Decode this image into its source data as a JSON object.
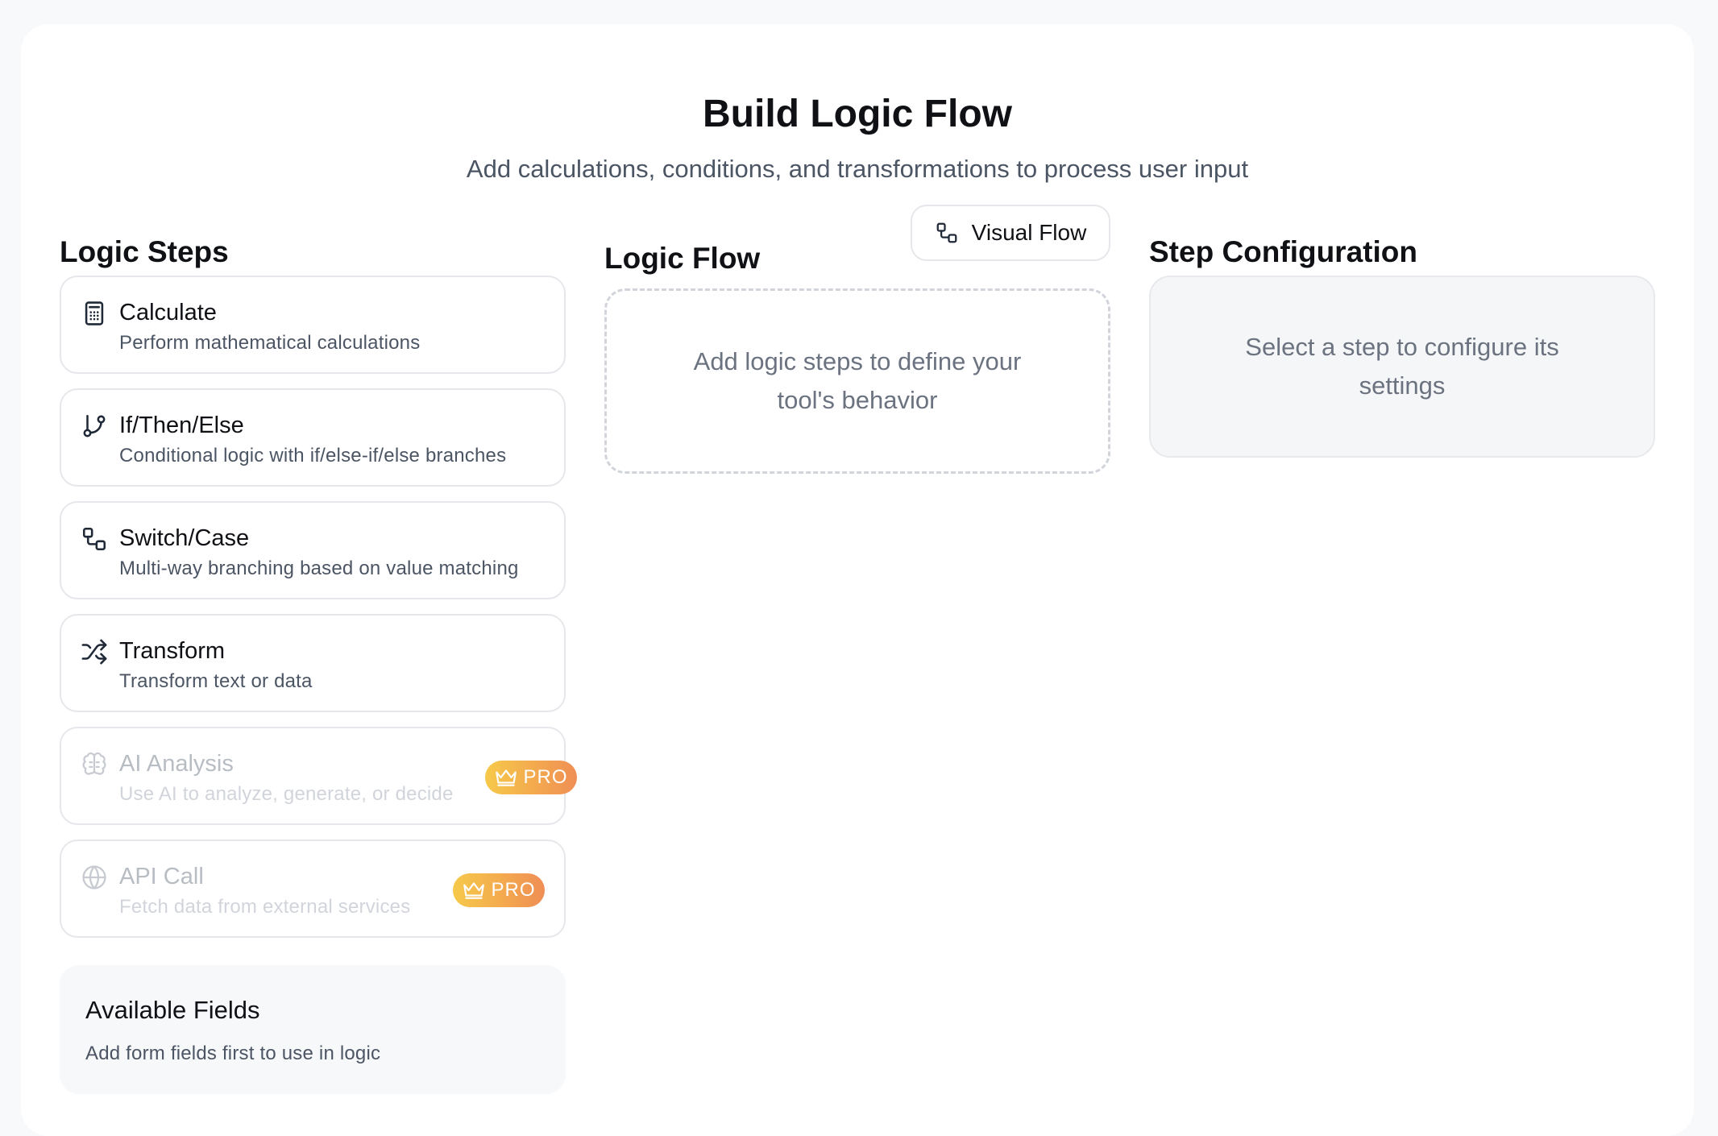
{
  "header": {
    "title": "Build Logic Flow",
    "subtitle": "Add calculations, conditions, and transformations to process user input"
  },
  "logic_steps": {
    "title": "Logic Steps",
    "items": [
      {
        "label": "Calculate",
        "description": "Perform mathematical calculations",
        "icon": "calculator-icon",
        "pro": false
      },
      {
        "label": "If/Then/Else",
        "description": "Conditional logic with if/else-if/else branches",
        "icon": "git-branch-icon",
        "pro": false
      },
      {
        "label": "Switch/Case",
        "description": "Multi-way branching based on value matching",
        "icon": "workflow-icon",
        "pro": false
      },
      {
        "label": "Transform",
        "description": "Transform text or data",
        "icon": "shuffle-icon",
        "pro": false
      },
      {
        "label": "AI Analysis",
        "description": "Use AI to analyze, generate, or decide",
        "icon": "brain-icon",
        "pro": true,
        "badge": "PRO"
      },
      {
        "label": "API Call",
        "description": "Fetch data from external services",
        "icon": "globe-icon",
        "pro": true,
        "badge": "PRO"
      }
    ]
  },
  "available_fields": {
    "title": "Available Fields",
    "text": "Add form fields first to use in logic"
  },
  "logic_flow": {
    "title": "Logic Flow",
    "visual_flow_label": "Visual Flow",
    "empty_text": "Add logic steps to define your tool's behavior"
  },
  "step_configuration": {
    "title": "Step Configuration",
    "empty_text": "Select a step to configure its settings"
  },
  "colors": {
    "background": "#f8f9fa",
    "card": "#ffffff",
    "pro_badge_gradient": [
      "#f6c94a",
      "#ef8e55"
    ]
  }
}
